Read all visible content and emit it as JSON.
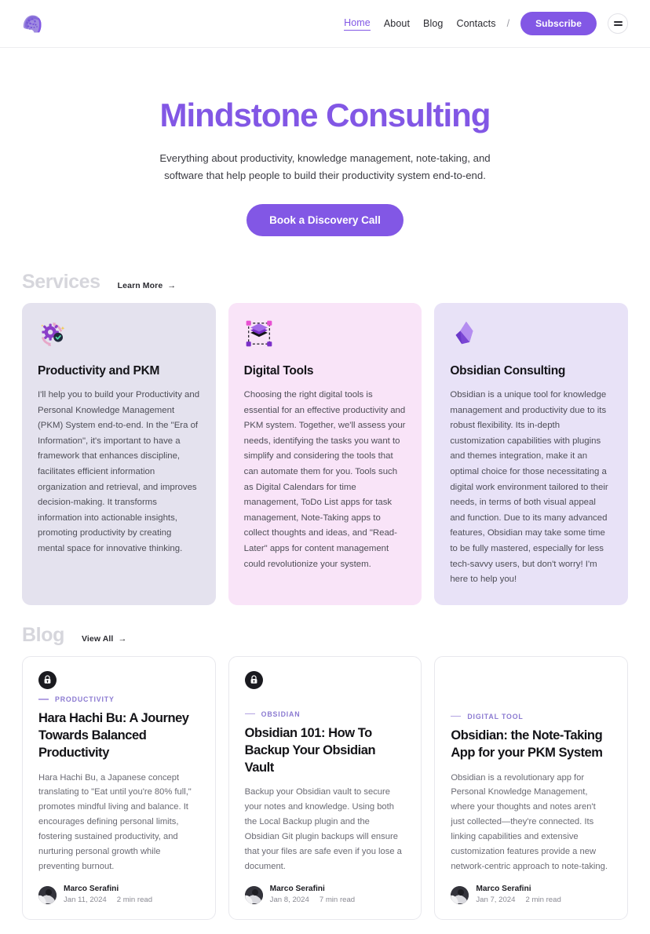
{
  "brand": {
    "logo_icon": "mindstone-head-logo",
    "accent_color": "#8257e5"
  },
  "header": {
    "nav": [
      {
        "label": "Home",
        "active": true
      },
      {
        "label": "About",
        "active": false
      },
      {
        "label": "Blog",
        "active": false
      },
      {
        "label": "Contacts",
        "active": false
      }
    ],
    "separator": "/",
    "subscribe_label": "Subscribe",
    "menu_icon": "hamburger-menu-icon"
  },
  "hero": {
    "title": "Mindstone Consulting",
    "subtitle": "Everything about productivity, knowledge management, note-taking, and software that help people to build their productivity system end-to-end.",
    "cta_label": "Book a Discovery Call"
  },
  "services": {
    "heading": "Services",
    "more_label": "Learn More",
    "more_arrow": "→",
    "cards": [
      {
        "icon": "gears-refresh-icon",
        "title": "Productivity and PKM",
        "body": "I'll help you to build your Productivity and Personal Knowledge Management (PKM) System end-to-end. In the \"Era of Information\", it's important to have a framework that enhances discipline, facilitates efficient information organization and retrieval, and improves decision-making. It transforms information into actionable insights, promoting productivity by creating mental space for innovative thinking.",
        "tone": "lavender"
      },
      {
        "icon": "layered-stack-select-icon",
        "title": "Digital Tools",
        "body": "Choosing the right digital tools is essential for an effective productivity and PKM system. Together, we'll assess your needs, identifying the tasks you want to simplify and considering the tools that can automate them for you. Tools such as Digital Calendars for time management, ToDo List apps for task management, Note-Taking apps to collect thoughts and ideas, and \"Read-Later\" apps for content management could revolutionize your system.",
        "tone": "pink"
      },
      {
        "icon": "obsidian-gem-icon",
        "title": "Obsidian Consulting",
        "body": "Obsidian is a unique tool for knowledge management and productivity due to its robust flexibility. Its in-depth customization capabilities with plugins and themes integration, make it an optimal choice for those necessitating a digital work environment tailored to their needs, in terms of both visual appeal and function. Due to its many advanced features, Obsidian may take some time to be fully mastered, especially for less tech-savvy users, but don't worry! I'm here to help you!",
        "tone": "violet"
      }
    ]
  },
  "blog": {
    "heading": "Blog",
    "more_label": "View All",
    "more_arrow": "→",
    "posts": [
      {
        "locked": true,
        "lock_icon": "lock-icon",
        "tag": "PRODUCTIVITY",
        "title": "Hara Hachi Bu: A Journey Towards Balanced Productivity",
        "excerpt": "Hara Hachi Bu, a Japanese concept translating to \"Eat until you're 80% full,\" promotes mindful living and balance. It encourages defining personal limits, fostering sustained productivity, and nurturing personal growth while preventing burnout.",
        "author": "Marco Serafini",
        "date": "Jan 11, 2024",
        "read_time": "2 min read"
      },
      {
        "locked": true,
        "lock_icon": "lock-icon",
        "tag": "OBSIDIAN",
        "title": "Obsidian 101: How To Backup Your Obsidian Vault",
        "excerpt": "Backup your Obsidian vault to secure your notes and knowledge. Using both the Local Backup plugin and the Obsidian Git plugin backups will ensure that your files are safe even if you lose a document.",
        "author": "Marco Serafini",
        "date": "Jan 8, 2024",
        "read_time": "7 min read"
      },
      {
        "locked": false,
        "lock_icon": "",
        "tag": "DIGITAL TOOL",
        "title": "Obsidian: the Note-Taking App for your PKM System",
        "excerpt": "Obsidian is a revolutionary app for Personal Knowledge Management, where your thoughts and notes aren't just collected—they're connected. Its linking capabilities and extensive customization features provide a new network-centric approach to note-taking.",
        "author": "Marco Serafini",
        "date": "Jan 7, 2024",
        "read_time": "2 min read"
      }
    ]
  }
}
